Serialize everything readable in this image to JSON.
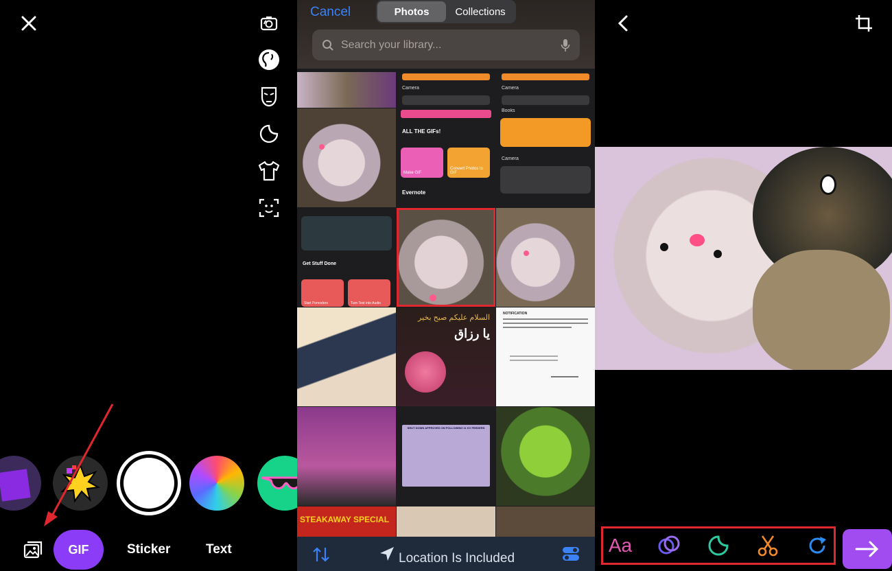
{
  "camera": {
    "modes": [
      "GIF",
      "Sticker",
      "Text"
    ],
    "side_tools": [
      "flip-camera-icon",
      "lighting-icon",
      "mask-icon",
      "sticker-icon",
      "shirt-icon",
      "face-scan-icon"
    ],
    "lenses": [
      "purple-lens",
      "burst-lens",
      "capture-button",
      "rainbow-lens",
      "sunglasses-lens"
    ]
  },
  "picker": {
    "cancel_label": "Cancel",
    "tabs": [
      "Photos",
      "Collections"
    ],
    "active_tab": "Photos",
    "search_placeholder": "Search your library...",
    "location_label": "Location Is Included",
    "thumbnails": {
      "shortcut_cards": [
        "Camera",
        "Books",
        "ALL THE GIFs!",
        "Make GIF",
        "Convert Photos to GIF",
        "Evernote",
        "Get Stuff Done",
        "Start Pomodoro",
        "Turn Text into Audio"
      ],
      "arabic_text": "يا رزاق",
      "arabic_greeting": "السلام عليكم صبح بخير",
      "notice_title": "NOTIFICATION",
      "table_title": "SHUT DOWN APPROVED ON FOLLOWING 11 KV FEEDERS",
      "banner_text": "STEAKAWAY SPECIAL"
    }
  },
  "editor": {
    "tools": [
      "Aa",
      "link-icon",
      "sticker-icon",
      "scissors-icon",
      "redo-icon"
    ],
    "accent": "#a14cf0"
  }
}
